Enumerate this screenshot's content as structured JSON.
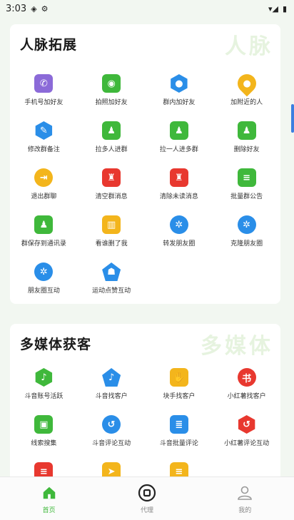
{
  "status": {
    "time": "3:03",
    "signal": "▾◢",
    "battery": "▮"
  },
  "section1": {
    "title": "人脉拓展",
    "watermark": "人脉",
    "items": [
      {
        "label": "手机号加好友",
        "icon": "phone-add-icon",
        "color": "#8b6ad8",
        "shape": "square",
        "glyph": "✆"
      },
      {
        "label": "拍照加好友",
        "icon": "camera-icon",
        "color": "#3fb83b",
        "shape": "square",
        "glyph": "◉"
      },
      {
        "label": "群内加好友",
        "icon": "group-user-icon",
        "color": "#2a8ee8",
        "shape": "hex",
        "glyph": "●"
      },
      {
        "label": "加附近的人",
        "icon": "location-pin-icon",
        "color": "#f3b51c",
        "shape": "pin",
        "glyph": "●"
      },
      {
        "label": "修改群备注",
        "icon": "edit-icon",
        "color": "#2a8ee8",
        "shape": "hex",
        "glyph": "✎"
      },
      {
        "label": "拉多人进群",
        "icon": "add-people-icon",
        "color": "#3fb83b",
        "shape": "square",
        "glyph": "♟"
      },
      {
        "label": "拉一人进多群",
        "icon": "chat-people-icon",
        "color": "#3fb83b",
        "shape": "square",
        "glyph": "♟"
      },
      {
        "label": "删除好友",
        "icon": "delete-friend-icon",
        "color": "#3fb83b",
        "shape": "square",
        "glyph": "♟"
      },
      {
        "label": "退出群聊",
        "icon": "exit-icon",
        "color": "#f3b51c",
        "shape": "round",
        "glyph": "⇥"
      },
      {
        "label": "清空群消息",
        "icon": "clear-message-icon",
        "color": "#e8382f",
        "shape": "square",
        "glyph": "♜"
      },
      {
        "label": "清除未读消息",
        "icon": "clear-unread-icon",
        "color": "#e8382f",
        "shape": "square",
        "glyph": "♜"
      },
      {
        "label": "批量群公告",
        "icon": "announcement-icon",
        "color": "#3fb83b",
        "shape": "square",
        "glyph": "≡"
      },
      {
        "label": "群保存到通讯录",
        "icon": "save-contacts-icon",
        "color": "#3fb83b",
        "shape": "square",
        "glyph": "♟"
      },
      {
        "label": "看谁删了我",
        "icon": "trash-icon",
        "color": "#f3b51c",
        "shape": "square",
        "glyph": "▥"
      },
      {
        "label": "转发朋友圈",
        "icon": "moments-forward-icon",
        "color": "#2a8ee8",
        "shape": "round",
        "glyph": "✲"
      },
      {
        "label": "克隆朋友圈",
        "icon": "moments-clone-icon",
        "color": "#2a8ee8",
        "shape": "round",
        "glyph": "✲"
      },
      {
        "label": "朋友圈互动",
        "icon": "moments-interact-icon",
        "color": "#2a8ee8",
        "shape": "round",
        "glyph": "✲"
      },
      {
        "label": "运动点赞互动",
        "icon": "sport-like-icon",
        "color": "#2a8ee8",
        "shape": "pent",
        "glyph": "☗"
      }
    ]
  },
  "section2": {
    "title": "多媒体获客",
    "watermark": "多媒体",
    "items": [
      {
        "label": "斗音账号活跃",
        "icon": "douyin-active-icon",
        "color": "#3fb83b",
        "shape": "hex",
        "glyph": "♪"
      },
      {
        "label": "斗音找客户",
        "icon": "douyin-customer-icon",
        "color": "#2a8ee8",
        "shape": "pent",
        "glyph": "♪"
      },
      {
        "label": "块手找客户",
        "icon": "kuaishou-icon",
        "color": "#f3b51c",
        "shape": "square",
        "glyph": "✋"
      },
      {
        "label": "小红薯找客户",
        "icon": "xiaohongshu-icon",
        "color": "#e8382f",
        "shape": "round",
        "glyph": "书"
      },
      {
        "label": "线索搜集",
        "icon": "tv-collect-icon",
        "color": "#3fb83b",
        "shape": "square",
        "glyph": "▣"
      },
      {
        "label": "斗音评论互动",
        "icon": "douyin-comment-icon",
        "color": "#2a8ee8",
        "shape": "round",
        "glyph": "↺"
      },
      {
        "label": "斗音批量评论",
        "icon": "batch-comment-icon",
        "color": "#2a8ee8",
        "shape": "square",
        "glyph": "≣"
      },
      {
        "label": "小红薯评论互动",
        "icon": "xhs-comment-icon",
        "color": "#e8382f",
        "shape": "hex",
        "glyph": "↺"
      },
      {
        "label": "",
        "icon": "red-doc-icon",
        "color": "#e8382f",
        "shape": "square",
        "glyph": "≡"
      },
      {
        "label": "",
        "icon": "send-icon",
        "color": "#f3b51c",
        "shape": "square",
        "glyph": "➤"
      },
      {
        "label": "",
        "icon": "yellow-chat-icon",
        "color": "#f3b51c",
        "shape": "square",
        "glyph": "≡"
      }
    ]
  },
  "nav": {
    "home": "首页",
    "agent": "代理",
    "mine": "我的"
  }
}
